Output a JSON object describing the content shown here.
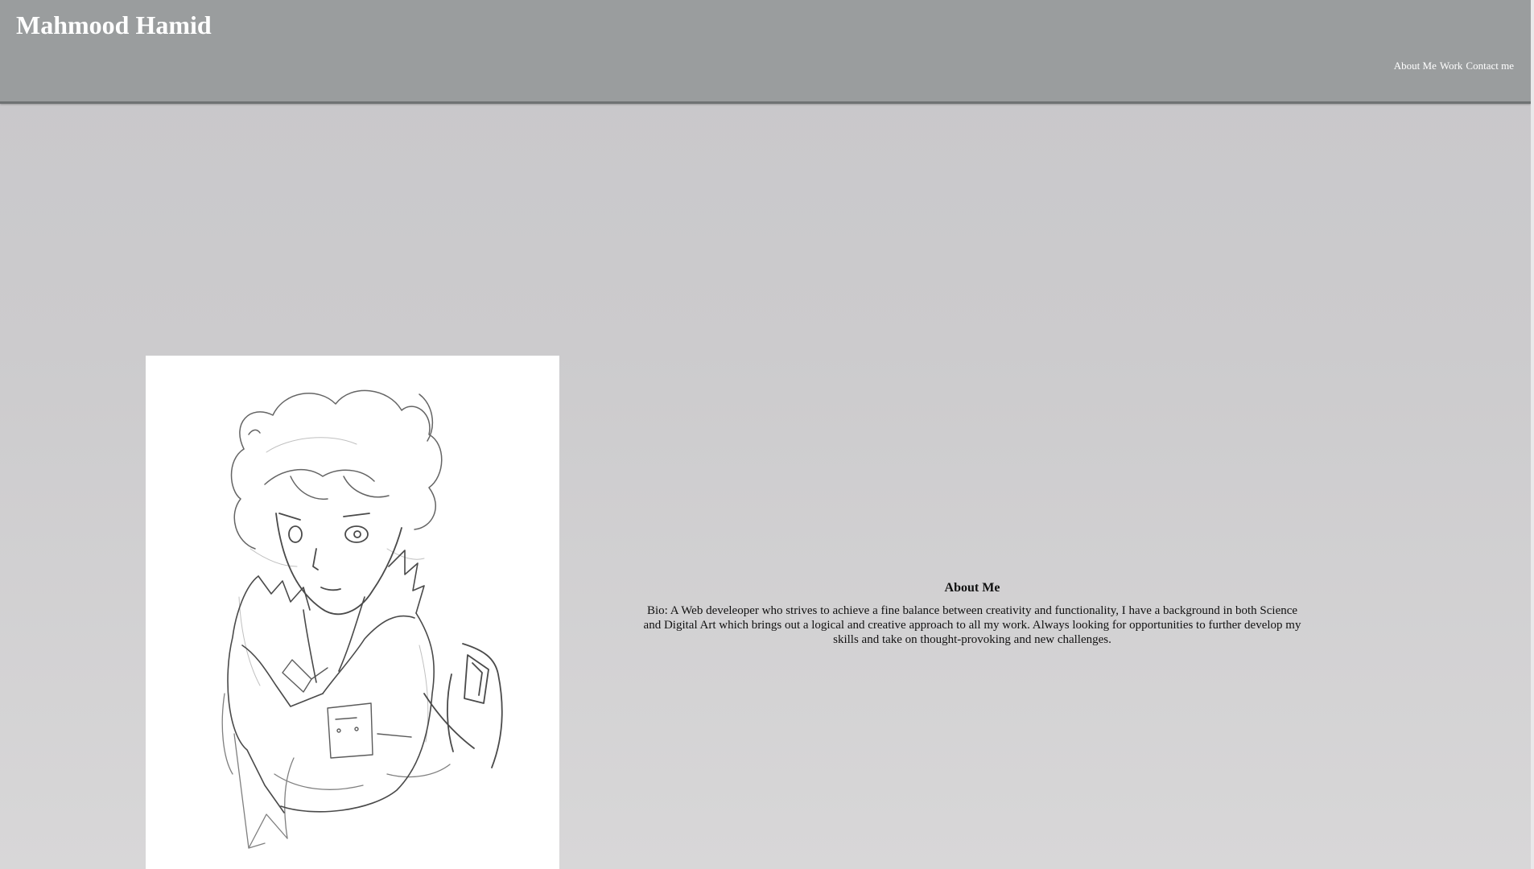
{
  "header": {
    "title": "Mahmood Hamid",
    "nav": [
      {
        "label": "About Me"
      },
      {
        "label": "Work"
      },
      {
        "label": "Contact me"
      }
    ]
  },
  "portrait": {
    "icon": "sketch-portrait-illustration"
  },
  "about": {
    "heading": "About Me",
    "bio": "Bio: A Web develeoper who strives to achieve a fine balance between creativity and functionality, I have a background in both Science and Digital Art which brings out a logical and creative approach to all my work. Always looking for opportunities to further develop my skills and take on thought-provoking and new challenges."
  },
  "colors": {
    "header_bg": "#9a9d9e",
    "page_bg_top": "#c8c7ca",
    "page_bg_bottom": "#d8d7d8",
    "header_text": "#ffffff",
    "body_text": "#111111"
  }
}
